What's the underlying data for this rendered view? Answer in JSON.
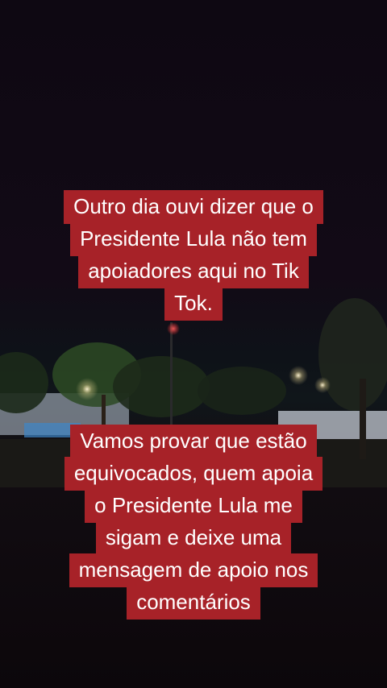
{
  "scene": {
    "description_icon": "night-park-photo",
    "colors": {
      "sky": "#0e0812",
      "caption_bg": "#a72228",
      "caption_text": "#ffffff"
    }
  },
  "captions": {
    "top": {
      "lines": [
        "Outro dia ouvi dizer que o",
        "Presidente Lula não tem",
        "apoiadores aqui no Tik",
        "Tok."
      ]
    },
    "bottom": {
      "lines": [
        "Vamos provar que estão",
        "equivocados, quem apoia",
        "o Presidente Lula me",
        "sigam e deixe uma",
        "mensagem de apoio nos",
        "comentários"
      ]
    }
  }
}
